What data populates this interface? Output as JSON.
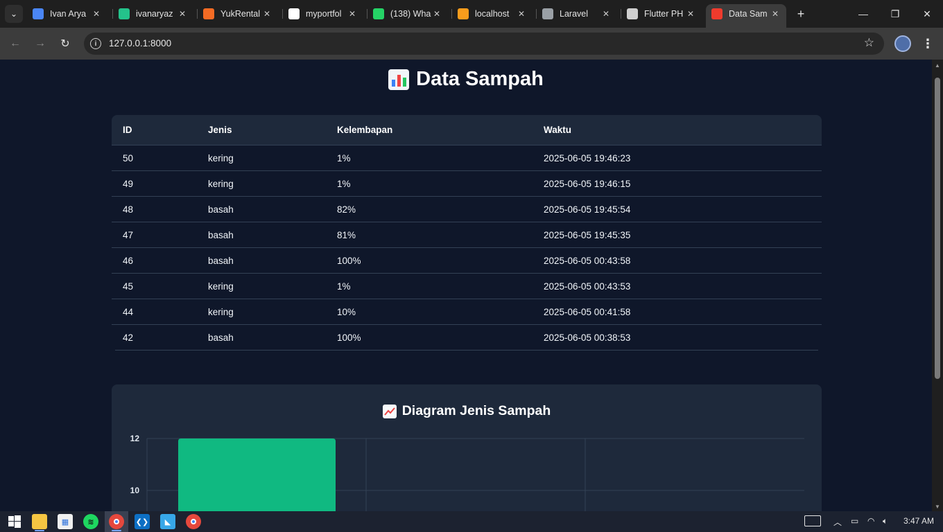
{
  "browser": {
    "tabs": [
      {
        "title": "Ivan Arya",
        "favicon_icon": "docs-icon",
        "favicon_color": "#4a86f7"
      },
      {
        "title": "ivanaryaz",
        "favicon_icon": "mountain-icon",
        "favicon_color": "#24c38b"
      },
      {
        "title": "YukRental",
        "favicon_icon": "xampp-icon",
        "favicon_color": "#f46b24"
      },
      {
        "title": "myportfol",
        "favicon_icon": "github-icon",
        "favicon_color": "#ffffff"
      },
      {
        "title": "(138) Wha",
        "favicon_icon": "whatsapp-icon",
        "favicon_color": "#25d366"
      },
      {
        "title": "localhost",
        "favicon_icon": "phpmyadmin-icon",
        "favicon_color": "#f89c1c"
      },
      {
        "title": "Laravel",
        "favicon_icon": "globe-icon",
        "favicon_color": "#9aa0a6"
      },
      {
        "title": "Flutter PH",
        "favicon_icon": "flutter-icon",
        "favicon_color": "#cfcfcf"
      },
      {
        "title": "Data Sam",
        "favicon_icon": "laravel-icon",
        "favicon_color": "#ef3b2d",
        "active": true
      }
    ],
    "url": "127.0.0.1:8000"
  },
  "page": {
    "title": "Data Sampah",
    "table": {
      "headers": [
        "ID",
        "Jenis",
        "Kelembapan",
        "Waktu"
      ],
      "rows": [
        [
          "50",
          "kering",
          "1%",
          "2025-06-05 19:46:23"
        ],
        [
          "49",
          "kering",
          "1%",
          "2025-06-05 19:46:15"
        ],
        [
          "48",
          "basah",
          "82%",
          "2025-06-05 19:45:54"
        ],
        [
          "47",
          "basah",
          "81%",
          "2025-06-05 19:45:35"
        ],
        [
          "46",
          "basah",
          "100%",
          "2025-06-05 00:43:58"
        ],
        [
          "45",
          "kering",
          "1%",
          "2025-06-05 00:43:53"
        ],
        [
          "44",
          "kering",
          "10%",
          "2025-06-05 00:41:58"
        ],
        [
          "42",
          "basah",
          "100%",
          "2025-06-05 00:38:53"
        ]
      ]
    },
    "chart_title": "Diagram Jenis Sampah"
  },
  "chart_data": {
    "type": "bar",
    "title": "Diagram Jenis Sampah",
    "yticks": [
      "12",
      "10"
    ],
    "visible_y_range": [
      10,
      12
    ],
    "values": [
      12
    ],
    "bar_color": "#10b981",
    "grid": true,
    "xlabel": "",
    "ylabel": ""
  },
  "taskbar": {
    "clock": "3:47 AM"
  }
}
